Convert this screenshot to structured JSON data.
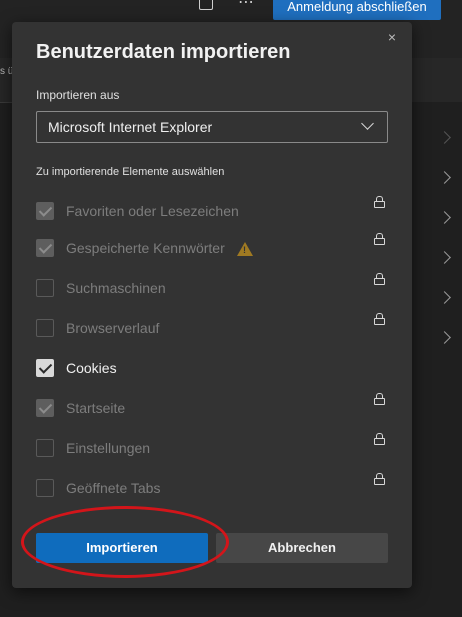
{
  "background": {
    "signin_button": "Anmeldung abschließen",
    "more_icon": "⋯",
    "strip_text": "s ü"
  },
  "dialog": {
    "title": "Benutzerdaten importieren",
    "close_icon": "×",
    "source_label": "Importieren aus",
    "source_value": "Microsoft Internet Explorer",
    "items_label": "Zu importierende Elemente auswählen",
    "items": [
      {
        "label": "Favoriten oder Lesezeichen",
        "checked": true,
        "enabled": false,
        "lock": true
      },
      {
        "label": "Gespeicherte Kennwörter",
        "checked": true,
        "enabled": false,
        "lock": true,
        "warning": true
      },
      {
        "label": "Suchmaschinen",
        "checked": false,
        "enabled": false,
        "lock": true
      },
      {
        "label": "Browserverlauf",
        "checked": false,
        "enabled": false,
        "lock": true
      },
      {
        "label": "Cookies",
        "checked": true,
        "enabled": true,
        "lock": false
      },
      {
        "label": "Startseite",
        "checked": true,
        "enabled": false,
        "lock": true
      },
      {
        "label": "Einstellungen",
        "checked": false,
        "enabled": false,
        "lock": true
      },
      {
        "label": "Geöffnete Tabs",
        "checked": false,
        "enabled": false,
        "lock": true
      }
    ],
    "warning_glyph": "!",
    "import_button": "Importieren",
    "cancel_button": "Abbrechen"
  },
  "colors": {
    "accent": "#0f6cbd",
    "annotation_ring": "#d3151a",
    "warning": "#a07a22"
  }
}
